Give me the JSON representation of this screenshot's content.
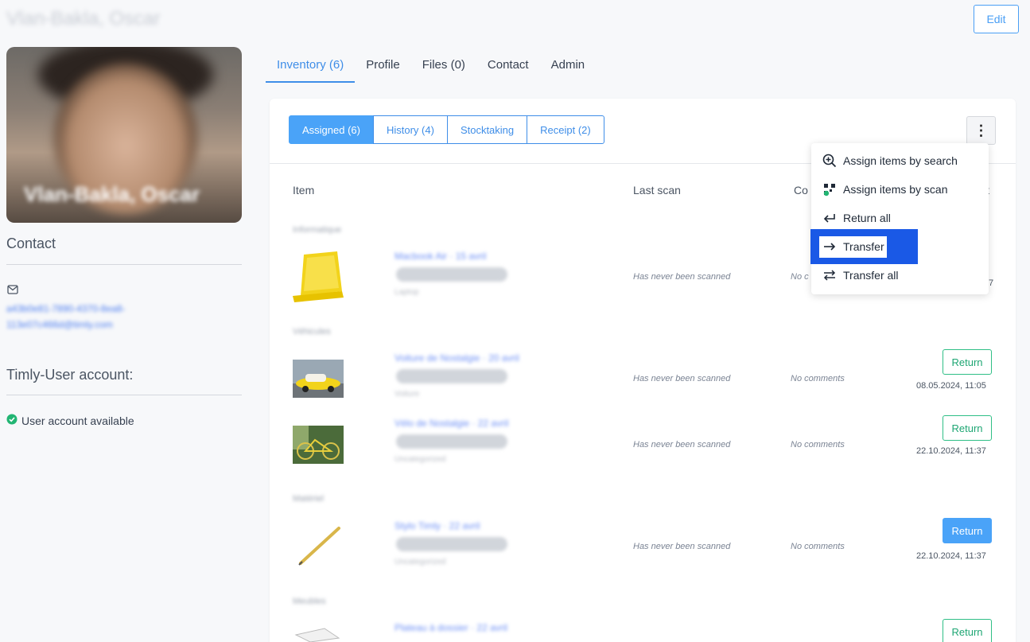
{
  "header": {
    "title": "Vlan-Bakla, Oscar",
    "edit_label": "Edit"
  },
  "profile": {
    "avatar_name": "Vlan-Bakla, Oscar",
    "contact_heading": "Contact",
    "email_line1": "a43b0e81-7890-4370-8ea8-",
    "email_line2": "113e07c466d@timly.com",
    "account_heading": "Timly-User account:",
    "account_status": "User account available"
  },
  "tabs": [
    {
      "label": "Inventory (6)",
      "active": true
    },
    {
      "label": "Profile"
    },
    {
      "label": "Files (0)"
    },
    {
      "label": "Contact"
    },
    {
      "label": "Admin"
    }
  ],
  "subtabs": [
    {
      "label": "Assigned (6)",
      "active": true
    },
    {
      "label": "History (4)"
    },
    {
      "label": "Stocktaking"
    },
    {
      "label": "Receipt (2)"
    }
  ],
  "table": {
    "headers": {
      "item": "Item",
      "last_scan": "Last scan",
      "comments": "Co",
      "return_col": "t"
    },
    "rows": [
      {
        "category": "Informatique",
        "name": "Macbook Air · 15 avril",
        "location": "Bureau de Barcilo",
        "sub": "Laptop",
        "last_scan": "Has never been scanned",
        "comment": "No c",
        "date": "7"
      },
      {
        "category": "Véhicules",
        "name": "Voiture de Nostalgie · 20 avril",
        "location": "Bureau de Barcilo",
        "sub": "Voiture",
        "last_scan": "Has never been scanned",
        "comment": "No comments",
        "return": "Return",
        "date": "08.05.2024, 11:05"
      },
      {
        "category": "",
        "name": "Vélo de Nostalgie · 22 avril",
        "location": "Bureau de Saint Blaise",
        "sub": "Uncategorized",
        "last_scan": "Has never been scanned",
        "comment": "No comments",
        "return": "Return",
        "date": "22.10.2024, 11:37"
      },
      {
        "category": "Matériel",
        "name": "Stylo Timly · 22 avril",
        "location": "Bureau de Barcilo",
        "sub": "Uncategorized",
        "last_scan": "Has never been scanned",
        "comment": "No comments",
        "return": "Return",
        "date": "22.10.2024, 11:37"
      },
      {
        "category": "Meubles",
        "name": "Plateau à dossier · 22 avril",
        "location": "",
        "sub": "",
        "last_scan": "",
        "comment": "",
        "return": "Return",
        "date": ""
      }
    ]
  },
  "menu": {
    "items": [
      {
        "label": "Assign items by search",
        "icon": "zoom-in-icon"
      },
      {
        "label": "Assign items by scan",
        "icon": "qr-scan-icon"
      },
      {
        "label": "Return all",
        "icon": "return-arrow-icon"
      },
      {
        "label": "Transfer",
        "icon": "arrow-right-icon"
      },
      {
        "label": "Transfer all",
        "icon": "swap-arrows-icon"
      }
    ]
  },
  "colors": {
    "accent": "#3f8ee8",
    "return_green": "#1ea673",
    "highlight": "#1a59e6"
  }
}
